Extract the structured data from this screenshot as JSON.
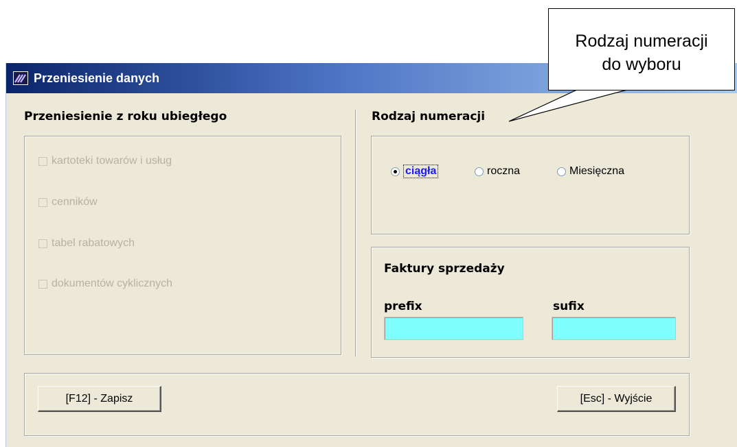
{
  "window": {
    "title": "Przeniesienie danych",
    "titlebar_colors": [
      "#0a246a",
      "#a6caf0"
    ],
    "background": "#ece9d8"
  },
  "transfer": {
    "heading": "Przeniesienie z roku ubiegłego",
    "options": [
      {
        "label": "kartoteki towarów i usług",
        "checked": false,
        "enabled": false
      },
      {
        "label": "cenników",
        "checked": false,
        "enabled": false
      },
      {
        "label": "tabel rabatowych",
        "checked": false,
        "enabled": false
      },
      {
        "label": "dokumentów cyklicznych",
        "checked": false,
        "enabled": false
      }
    ]
  },
  "numbering": {
    "heading": "Rodzaj numeracji",
    "options": [
      {
        "label": "ciągła",
        "selected": true
      },
      {
        "label": "roczna",
        "selected": false
      },
      {
        "label": "Miesięczna",
        "selected": false
      }
    ]
  },
  "invoices": {
    "heading": "Faktury sprzedaży",
    "prefix_label": "prefix",
    "prefix_value": "",
    "sufix_label": "sufix",
    "sufix_value": "",
    "field_color": "#80ffff"
  },
  "buttons": {
    "save": "[F12] - Zapisz",
    "exit": "[Esc] - Wyjście"
  },
  "callout": {
    "line1": "Rodzaj numeracji",
    "line2": "do wyboru"
  }
}
